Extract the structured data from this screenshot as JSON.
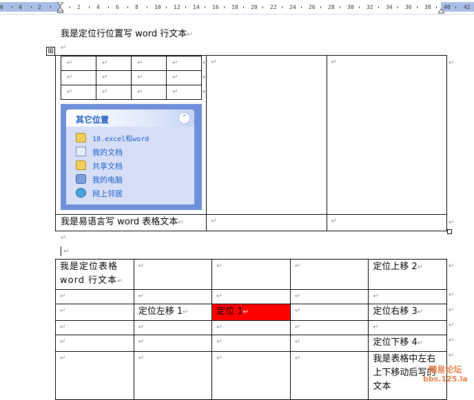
{
  "ruler": {
    "numbers": [
      "6",
      "4",
      "2",
      "2",
      "4",
      "6",
      "8",
      "10",
      "12",
      "14",
      "16",
      "18",
      "20",
      "22",
      "24",
      "26",
      "28",
      "30",
      "32",
      "34",
      "36",
      "38",
      "40",
      "42"
    ]
  },
  "doc": {
    "para1": "我是定位行位置写 word 行文本",
    "pm": "↵",
    "cell_text_1": "我是易语言写 word 表格文本",
    "table2": {
      "r1c1": "我是定位表格word 行文本",
      "r1c5": "定位上移 2",
      "r3c2": "定位左移 1",
      "r3c3": "定位 1",
      "r3c5": "定位右移 3",
      "r5c5": "定位下移 4",
      "r6c5": "我是表格中左右上下移动后写的文本"
    },
    "table_handle": "⊞"
  },
  "pane": {
    "title": "其它位置",
    "collapse": "⌃",
    "items": [
      {
        "label": "18.excel和word",
        "icon": "folder-icon"
      },
      {
        "label": "我的文档",
        "icon": "documents-icon"
      },
      {
        "label": "共享文档",
        "icon": "folder-icon"
      },
      {
        "label": "我的电脑",
        "icon": "computer-icon"
      },
      {
        "label": "网上邻居",
        "icon": "network-icon"
      }
    ]
  },
  "watermark": {
    "line1": "精易论坛",
    "line2": "bbs.125.la"
  },
  "colors": {
    "highlight": "#ff0000",
    "pane_bg": "#6f8fd9",
    "ruler_grey": "#a9bde6"
  }
}
